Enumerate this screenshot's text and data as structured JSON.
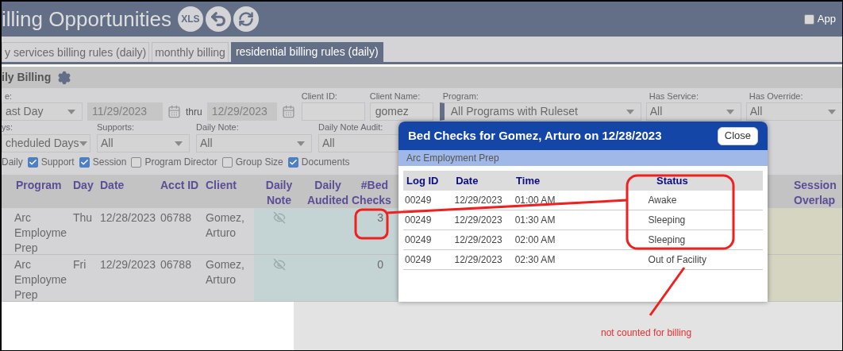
{
  "header": {
    "title": "illing Opportunities",
    "buttons": [
      {
        "kind": "xls",
        "label": "XLS"
      },
      {
        "kind": "undo"
      },
      {
        "kind": "refresh"
      }
    ],
    "approve": {
      "label": "App",
      "checked": false
    }
  },
  "tabs": [
    {
      "label": "y services billing rules (daily)",
      "selected": false
    },
    {
      "label": "monthly billing",
      "selected": false
    },
    {
      "label": "residential billing rules (daily)",
      "selected": true
    }
  ],
  "section": {
    "title": "ily Billing"
  },
  "filters": {
    "row_1": [
      {
        "kind": "select",
        "label": "e:",
        "value": "ast Day"
      },
      {
        "kind": "date",
        "value": "11/29/2023",
        "disabled": true
      },
      {
        "kind": "text",
        "value": "thru"
      },
      {
        "kind": "date",
        "value": "12/29/2023",
        "disabled": true
      },
      {
        "kind": "input",
        "label": "Client ID:"
      },
      {
        "kind": "input",
        "label": "Client Name:",
        "value": "gomez"
      },
      {
        "kind": "select",
        "label": "Program:",
        "value": "All Programs with Ruleset"
      },
      {
        "kind": "select",
        "label": "Has Service:",
        "value": "All"
      },
      {
        "kind": "select",
        "label": "Has Override:",
        "value": "All"
      }
    ],
    "row_2": [
      {
        "label": "ys:",
        "value": "cheduled Days"
      },
      {
        "label": "Supports:",
        "value": "All"
      },
      {
        "label": "Daily Note:",
        "value": "All"
      },
      {
        "label": "Daily Note Audit:",
        "value": "All"
      }
    ],
    "checkboxes": [
      {
        "label": "Daily"
      },
      {
        "label": "Support",
        "checked": true
      },
      {
        "label": "Session",
        "checked": true
      },
      {
        "label": "Program Director",
        "checked": false
      },
      {
        "label": "Group Size",
        "checked": false
      },
      {
        "label": "Documents",
        "checked": true
      }
    ]
  },
  "table": {
    "columns": [
      "Program",
      "Day",
      "Date",
      "Acct ID",
      "Client",
      "Daily Note",
      "Daily Audited",
      "#Bed Checks",
      "Session Overlap"
    ],
    "rows": [
      {
        "program": "Arc Employme Prep",
        "day": "Thu",
        "date": "12/28/2023",
        "acct_id": "06788",
        "client": "Gomez, Arturo",
        "bed_checks": "3"
      },
      {
        "program": "Arc Employme Prep",
        "day": "Fri",
        "date": "12/29/2023",
        "acct_id": "06788",
        "client": "Gomez, Arturo",
        "bed_checks": "0"
      }
    ]
  },
  "modal": {
    "title": "Bed Checks for Gomez, Arturo on 12/28/2023",
    "close": "Close",
    "subtitle": "Arc Employment Prep",
    "columns": [
      "Log ID",
      "Date",
      "Time",
      "Status"
    ],
    "rows": [
      [
        "00249",
        "12/29/2023",
        "01:00 AM",
        "Awake"
      ],
      [
        "00249",
        "12/29/2023",
        "01:30 AM",
        "Sleeping"
      ],
      [
        "00249",
        "12/29/2023",
        "02:00 AM",
        "Sleeping"
      ],
      [
        "00249",
        "12/29/2023",
        "02:30 AM",
        "Out of Facility"
      ]
    ]
  },
  "annotation": {
    "note": "not counted for billing"
  }
}
